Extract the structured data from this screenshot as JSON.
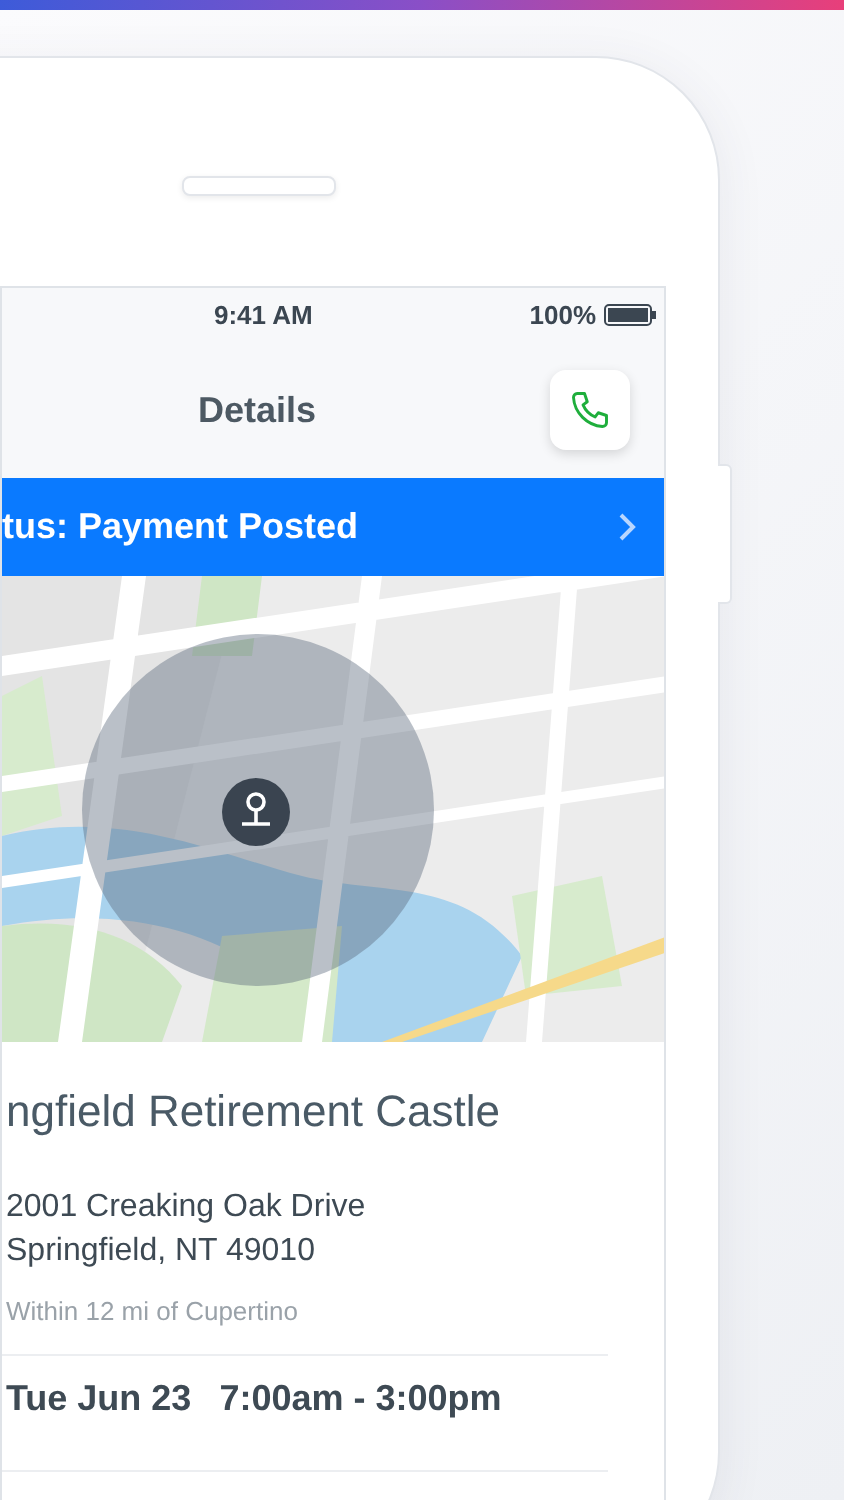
{
  "status_bar": {
    "time": "9:41 AM",
    "battery": "100%"
  },
  "nav": {
    "title": "Details"
  },
  "status_banner": {
    "text": "tus: Payment Posted"
  },
  "location": {
    "name": "ngfield Retirement Castle",
    "address_lines": [
      "2001 Creaking Oak Drive",
      "Springfield, NT 49010"
    ],
    "distance": "Within 12 mi of Cupertino"
  },
  "schedule": {
    "date": "Tue Jun 23",
    "hours": "7:00am - 3:00pm"
  }
}
